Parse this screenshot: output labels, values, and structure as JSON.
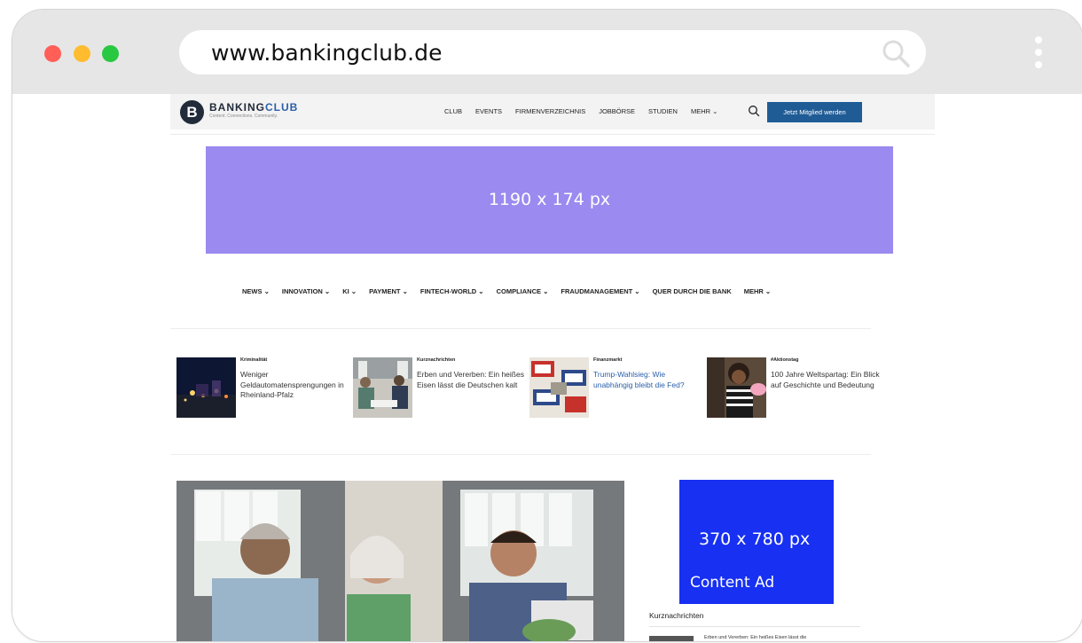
{
  "browser": {
    "url": "www.bankingclub.de"
  },
  "site": {
    "logo": {
      "mark": "B",
      "name_part1": "BANKING",
      "name_part2": "CLUB",
      "tagline": "Content. Connections. Community."
    },
    "top_menu": [
      {
        "label": "CLUB"
      },
      {
        "label": "EVENTS"
      },
      {
        "label": "FIRMENVERZEICHNIS"
      },
      {
        "label": "JOBBÖRSE"
      },
      {
        "label": "STUDIEN"
      },
      {
        "label": "MEHR ⌄"
      }
    ],
    "cta_label": "Jetzt Mitglied werden",
    "banner_label": "1190 x 174 px",
    "main_nav": [
      {
        "label": "NEWS ⌄"
      },
      {
        "label": "INNOVATION ⌄"
      },
      {
        "label": "KI ⌄"
      },
      {
        "label": "PAYMENT ⌄"
      },
      {
        "label": "FINTECH-WORLD ⌄"
      },
      {
        "label": "COMPLIANCE ⌄"
      },
      {
        "label": "FRAUDMANAGEMENT ⌄"
      },
      {
        "label": "QUER DURCH DIE BANK"
      },
      {
        "label": "MEHR ⌄"
      }
    ],
    "cards": [
      {
        "category": "Kriminalität",
        "title": "Weniger Geldautomatensprengungen in Rheinland-Pfalz"
      },
      {
        "category": "Kurznachrichten",
        "title": "Erben und Vererben: Ein heißes Eisen lässt die Deutschen kalt"
      },
      {
        "category": "Finanzmarkt",
        "title": "Trump-Wahlsieg: Wie unabhängig bleibt die Fed?"
      },
      {
        "category": "#Aktionstag",
        "title": "100 Jahre Weltspartag: Ein Blick auf Geschichte und Bedeutung"
      }
    ],
    "content_ad": {
      "size": "370 x 780 px",
      "label": "Content Ad"
    },
    "sidebar": {
      "heading": "Kurznachrichten",
      "first_item": "Erben und Vererben: Ein heißes Eisen lässt die"
    },
    "colors": {
      "banner": "#9b8aef",
      "content_ad": "#1730f2",
      "cta": "#1f5c96",
      "link": "#2a5fa8"
    }
  }
}
